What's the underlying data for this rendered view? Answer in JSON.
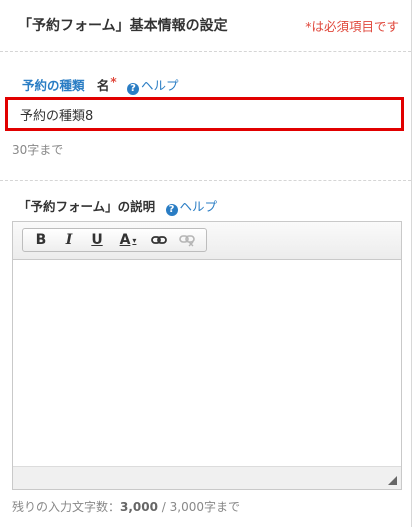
{
  "header": {
    "title": "「予約フォーム」基本情報の設定",
    "required_note": "*は必須項目です"
  },
  "name_field": {
    "label_part1": "予約の種類",
    "label_part2": "名",
    "required_mark": "*",
    "help_icon": "?",
    "help_label": "ヘルプ",
    "value": "予約の種類8",
    "hint": "30字まで"
  },
  "description_field": {
    "label": "「予約フォーム」の説明",
    "help_icon": "?",
    "help_label": "ヘルプ",
    "toolbar": {
      "bold": "B",
      "italic": "I",
      "underline": "U",
      "font_color": "A",
      "font_color_caret": "▾"
    },
    "counter_prefix": "残りの入力文字数：",
    "counter_value": "3,000",
    "counter_suffix": " / 3,000字まで"
  },
  "colors": {
    "accent_blue": "#2a7dc4",
    "required_red": "#e0473b",
    "focus_border": "#e10000"
  },
  "icons": [
    "help-icon",
    "link-icon",
    "unlink-icon",
    "resize-grip-icon"
  ]
}
